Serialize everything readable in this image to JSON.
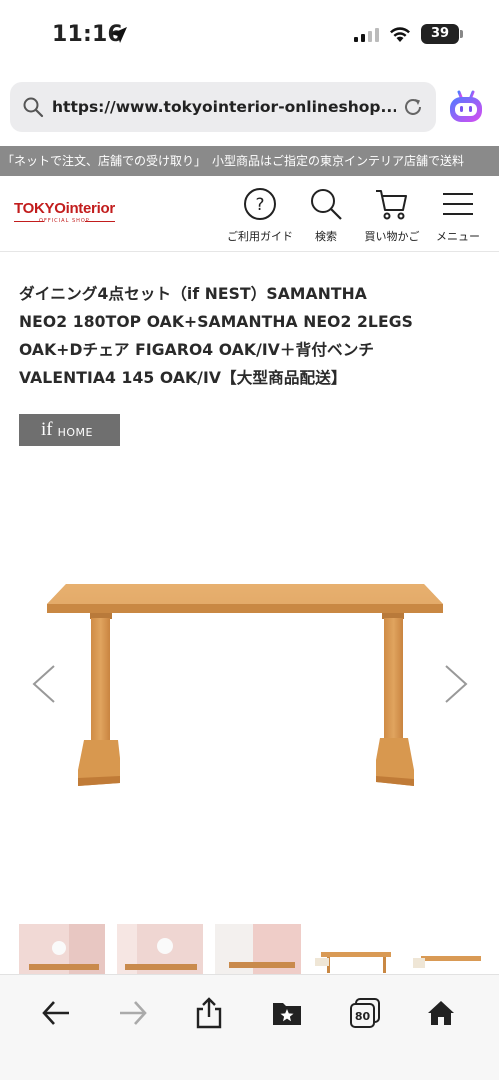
{
  "status_bar": {
    "time": "11:16",
    "battery": "39"
  },
  "browser": {
    "url": "https://www.tokyointerior-onlineshop...",
    "tab_count": "80"
  },
  "ticker": {
    "text": "「ネットで注文、店舗での受け取り」　小型商品はご指定の東京インテリア店舗で送料"
  },
  "header": {
    "logo_main": "TOKYO",
    "logo_interior": "interior",
    "logo_sub": "OFFICIAL SHOP",
    "nav": [
      {
        "label": "ご利用ガイド",
        "icon": "help-circle-icon"
      },
      {
        "label": "検索",
        "icon": "search-icon"
      },
      {
        "label": "買い物かご",
        "icon": "cart-icon"
      },
      {
        "label": "メニュー",
        "icon": "hamburger-menu-icon"
      }
    ]
  },
  "product": {
    "title_lines": [
      "ダイニング4点セット（if NEST）SAMANTHA",
      "NEO2 180TOP OAK+SAMANTHA NEO2 2LEGS",
      "OAK+Dチェア FIGARO4 OAK/IV＋背付ベンチ",
      "VALENTIA4 145 OAK/IV【大型商品配送】"
    ],
    "brand_badge_main": "if",
    "brand_badge_sub": "HOME"
  },
  "colors": {
    "brand_red": "#c21d1d",
    "ticker_bg": "#8a8a8a",
    "badge_bg": "#6f6f6f",
    "wood": "#d99a55"
  }
}
